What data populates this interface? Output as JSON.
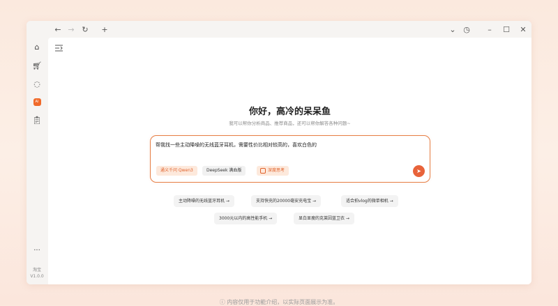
{
  "titlebar": {
    "back_icon": "arrow-left-icon",
    "forward_icon": "arrow-right-icon",
    "refresh_icon": "refresh-icon",
    "new_tab_icon": "plus-icon",
    "dropdown_icon": "chevron-down-icon",
    "history_icon": "clock-icon",
    "minimize_icon": "minimize-icon",
    "maximize_icon": "maximize-icon",
    "close_icon": "close-icon"
  },
  "sidebar": {
    "items": [
      {
        "icon": "home-icon"
      },
      {
        "icon": "cart-icon"
      },
      {
        "icon": "chat-icon"
      },
      {
        "icon": "ai-icon",
        "label": "AI"
      },
      {
        "icon": "clipboard-icon"
      }
    ],
    "more": "···",
    "app_name": "淘宝",
    "version": "V1.0.0"
  },
  "main": {
    "heading": "你好，高冷的呆呆鱼",
    "subheading": "我可以帮你分析商品、推荐商品，还可以帮你解答各种问题~",
    "input_value": "帮我找一些主动降噪的无线蓝牙耳机，需要性价比相对较高的，喜欢白色的",
    "chips": {
      "qwen": "通义千问 Qwen3",
      "deepseek": "DeepSeek 满血版",
      "deep_think": "深度思考"
    },
    "suggestions": [
      "主动降噪的无线蓝牙耳机 →",
      "支持快充的20000毫安充电宝 →",
      "适合拍vlog的微单相机 →",
      "3000元以内的高性能手机 →",
      "显白显瘦的克莱因蓝卫衣 →"
    ]
  },
  "footer": {
    "note": "ⓘ 内容仅用于功能介绍，以实际页面展示为准。"
  },
  "colors": {
    "accent": "#e8633a",
    "accent_light": "#fde9dc",
    "background": "#fbe9de"
  }
}
